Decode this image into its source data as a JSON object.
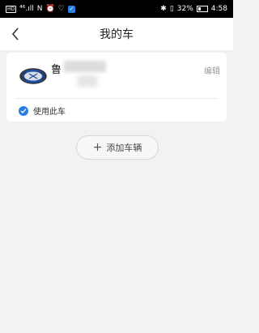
{
  "status_bar": {
    "hd_label": "HD",
    "signal": "⁴⁶.ıll",
    "nfc": "N",
    "battery_percent": "32%",
    "time": "4:58"
  },
  "header": {
    "title": "我的车"
  },
  "car": {
    "plate_prefix": "鲁",
    "edit_label": "编辑",
    "use_label": "使用此车"
  },
  "add_button": {
    "label": "添加车辆"
  },
  "colors": {
    "accent": "#2a7de1",
    "background": "#f2f2f2",
    "card": "#ffffff"
  }
}
